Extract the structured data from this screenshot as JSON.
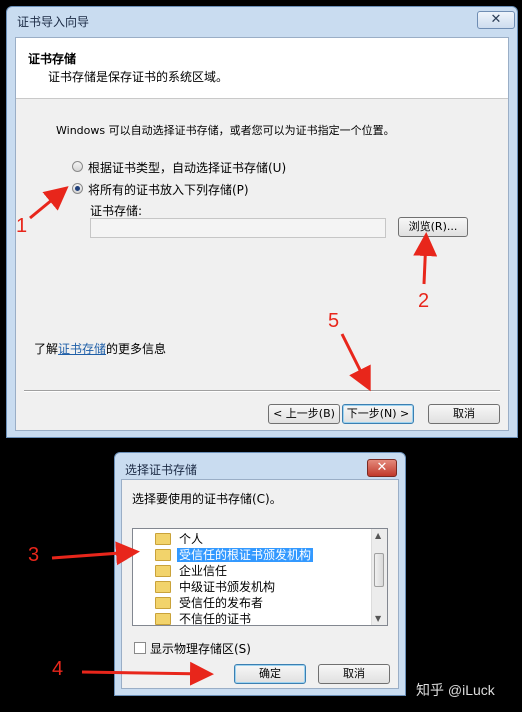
{
  "wizard": {
    "title": "证书导入向导",
    "close_label": "✕",
    "heading": "证书存储",
    "subheading": "证书存储是保存证书的系统区域。",
    "description": "Windows 可以自动选择证书存储，或者您可以为证书指定一个位置。",
    "radio_auto_label": "根据证书类型，自动选择证书存储(U)",
    "radio_manual_label": "将所有的证书放入下列存储(P)",
    "store_field_label": "证书存储:",
    "store_field_value": "",
    "browse_label": "浏览(R)...",
    "more_info_prefix": "了解",
    "more_info_link": "证书存储",
    "more_info_suffix": "的更多信息",
    "back_label": "< 上一步(B)",
    "next_label": "下一步(N) >",
    "cancel_label": "取消"
  },
  "dialog": {
    "title": "选择证书存储",
    "close_label": "✕",
    "prompt": "选择要使用的证书存储(C)。",
    "stores": [
      "个人",
      "受信任的根证书颁发机构",
      "企业信任",
      "中级证书颁发机构",
      "受信任的发布者",
      "不信任的证书"
    ],
    "selected_index": 1,
    "show_physical_label": "显示物理存储区(S)",
    "ok_label": "确定",
    "cancel_label": "取消"
  },
  "annotations": [
    "1",
    "2",
    "3",
    "4",
    "5"
  ],
  "watermark": "知乎 @iLuck",
  "colors": {
    "annotation": "#e8261b",
    "selection": "#3399ff"
  }
}
